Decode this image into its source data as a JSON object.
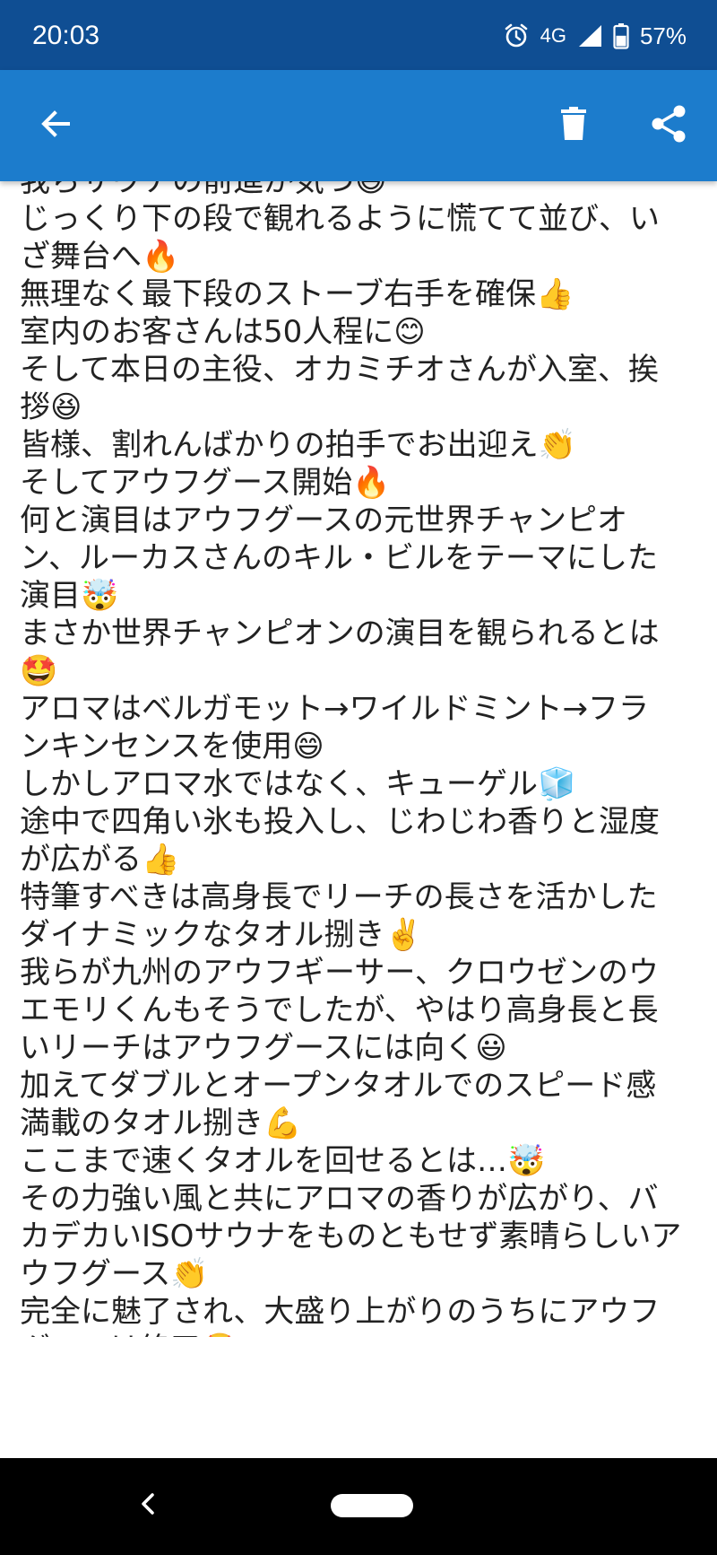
{
  "status_bar": {
    "time": "20:03",
    "network": "4G",
    "battery": "57%",
    "battery_level": 0.57,
    "icons": [
      "alarm-icon",
      "signal-icon",
      "battery-icon"
    ]
  },
  "app_bar": {
    "color": "#1c7ccc",
    "icons": [
      "back-arrow-icon",
      "trash-icon",
      "share-icon"
    ]
  },
  "content": {
    "lines": [
      "我らサウナの前進が気づ😄",
      "じっくり下の段で観れるように慌てて並び、い",
      "ざ舞台へ🔥",
      "無理なく最下段のストーブ右手を確保👍",
      "室内のお客さんは50人程に😊",
      "そして本日の主役、オカミチオさんが入室、挨",
      "拶😆",
      "皆様、割れんばかりの拍手でお出迎え👏",
      "そしてアウフグース開始🔥",
      "何と演目はアウフグースの元世界チャンピオ",
      "ン、ルーカスさんのキル・ビルをテーマにした",
      "演目🤯",
      "まさか世界チャンピオンの演目を観られるとは",
      "🤩",
      "アロマはベルガモット→ワイルドミント→フラ",
      "ンキンセンスを使用😄",
      "しかしアロマ水ではなく、キューゲル🧊",
      "途中で四角い氷も投入し、じわじわ香りと湿度",
      "が広がる👍",
      "特筆すべきは高身長でリーチの長さを活かした",
      "ダイナミックなタオル捌き✌️",
      "我らが九州のアウフギーサー、クロウゼンのウ",
      "エモリくんもそうでしたが、やはり高身長と長",
      "いリーチはアウフグースには向く😃",
      "加えてダブルとオープンタオルでのスピード感",
      "満載のタオル捌き💪",
      "ここまで速くタオルを回せるとは…🤯",
      "その力強い風と共にアロマの香りが広がり、バ",
      "カデカいISOサウナをものともせず素晴らしいア",
      "ウフグース👏",
      "完全に魅了され、大盛り上がりのうちにアウフ",
      "グースは終了🤩"
    ]
  },
  "nav_bar": {
    "icons": [
      "nav-back-icon",
      "home-pill-icon"
    ]
  }
}
